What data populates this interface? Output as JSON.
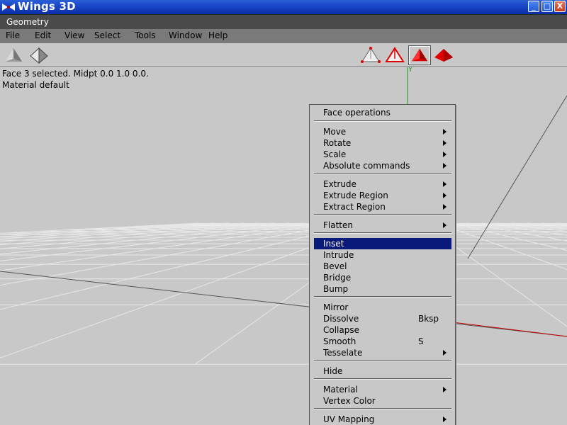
{
  "window": {
    "title": "Wings 3D",
    "minimize": "_",
    "maximize": "□",
    "close": "X"
  },
  "geometry_bar": {
    "title": "Geometry"
  },
  "menubar": {
    "items": [
      "File",
      "Edit",
      "View",
      "Select",
      "Tools",
      "Window",
      "Help"
    ]
  },
  "toolbar": {
    "left_tools": [
      "smooth-shading-icon",
      "wireframe-shading-icon"
    ],
    "right_tools": [
      "vertex-select-icon",
      "edge-select-icon",
      "face-select-icon",
      "body-select-icon"
    ],
    "active_tool": "face-select-icon",
    "accent": "#e00000"
  },
  "viewport": {
    "info_line1": "Face 3 selected. Midpt 0.0 1.0 0.0.",
    "info_line2": "Material default",
    "y_axis_label": "Y",
    "y_axis_color": "#1a9a1a",
    "x_axis_color": "#c00000"
  },
  "context_menu": {
    "header": "Face operations",
    "highlight_color": "#0a1a7a",
    "items": [
      {
        "label": "Move",
        "shortcut": "",
        "submenu": true
      },
      {
        "label": "Rotate",
        "shortcut": "",
        "submenu": true
      },
      {
        "label": "Scale",
        "shortcut": "",
        "submenu": true
      },
      {
        "label": "Absolute commands",
        "shortcut": "",
        "submenu": true
      },
      {
        "label": "Extrude",
        "shortcut": "",
        "submenu": true
      },
      {
        "label": "Extrude Region",
        "shortcut": "",
        "submenu": true
      },
      {
        "label": "Extract Region",
        "shortcut": "",
        "submenu": true
      },
      {
        "label": "Flatten",
        "shortcut": "",
        "submenu": true
      },
      {
        "label": "Inset",
        "shortcut": "",
        "submenu": false,
        "highlighted": true
      },
      {
        "label": "Intrude",
        "shortcut": "",
        "submenu": false
      },
      {
        "label": "Bevel",
        "shortcut": "",
        "submenu": false
      },
      {
        "label": "Bridge",
        "shortcut": "",
        "submenu": false
      },
      {
        "label": "Bump",
        "shortcut": "",
        "submenu": false
      },
      {
        "label": "Mirror",
        "shortcut": "",
        "submenu": false
      },
      {
        "label": "Dissolve",
        "shortcut": "Bksp",
        "submenu": false
      },
      {
        "label": "Collapse",
        "shortcut": "",
        "submenu": false
      },
      {
        "label": "Smooth",
        "shortcut": "S",
        "submenu": false
      },
      {
        "label": "Tesselate",
        "shortcut": "",
        "submenu": true
      },
      {
        "label": "Hide",
        "shortcut": "",
        "submenu": false
      },
      {
        "label": "Material",
        "shortcut": "",
        "submenu": true
      },
      {
        "label": "Vertex Color",
        "shortcut": "",
        "submenu": false
      },
      {
        "label": "UV Mapping",
        "shortcut": "",
        "submenu": true
      }
    ]
  }
}
